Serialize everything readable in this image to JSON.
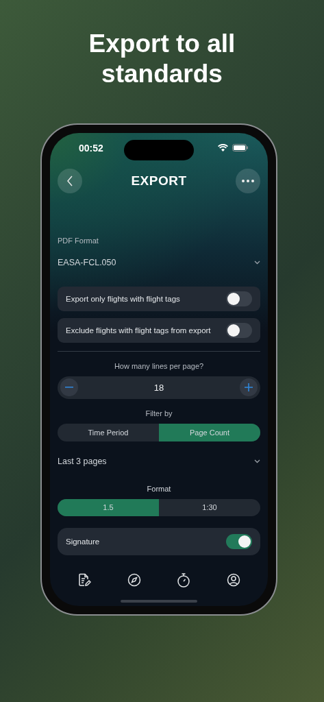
{
  "headline": "Export to all standards",
  "status_bar": {
    "time": "00:52"
  },
  "nav": {
    "title": "EXPORT"
  },
  "pdf_format": {
    "label": "PDF Format",
    "value": "EASA-FCL.050"
  },
  "toggles": [
    {
      "label": "Export only flights with flight tags",
      "on": false
    },
    {
      "label": "Exclude flights with flight tags from export",
      "on": false
    }
  ],
  "lines_per_page": {
    "label": "How many lines per page?",
    "value": "18"
  },
  "filter": {
    "label": "Filter by",
    "options": [
      {
        "label": "Time Period",
        "selected": false
      },
      {
        "label": "Page Count",
        "selected": true
      }
    ]
  },
  "range": {
    "value": "Last 3 pages"
  },
  "format": {
    "label": "Format",
    "options": [
      {
        "label": "1.5",
        "selected": true
      },
      {
        "label": "1:30",
        "selected": false
      }
    ]
  },
  "signature": {
    "label": "Signature",
    "on": true
  }
}
